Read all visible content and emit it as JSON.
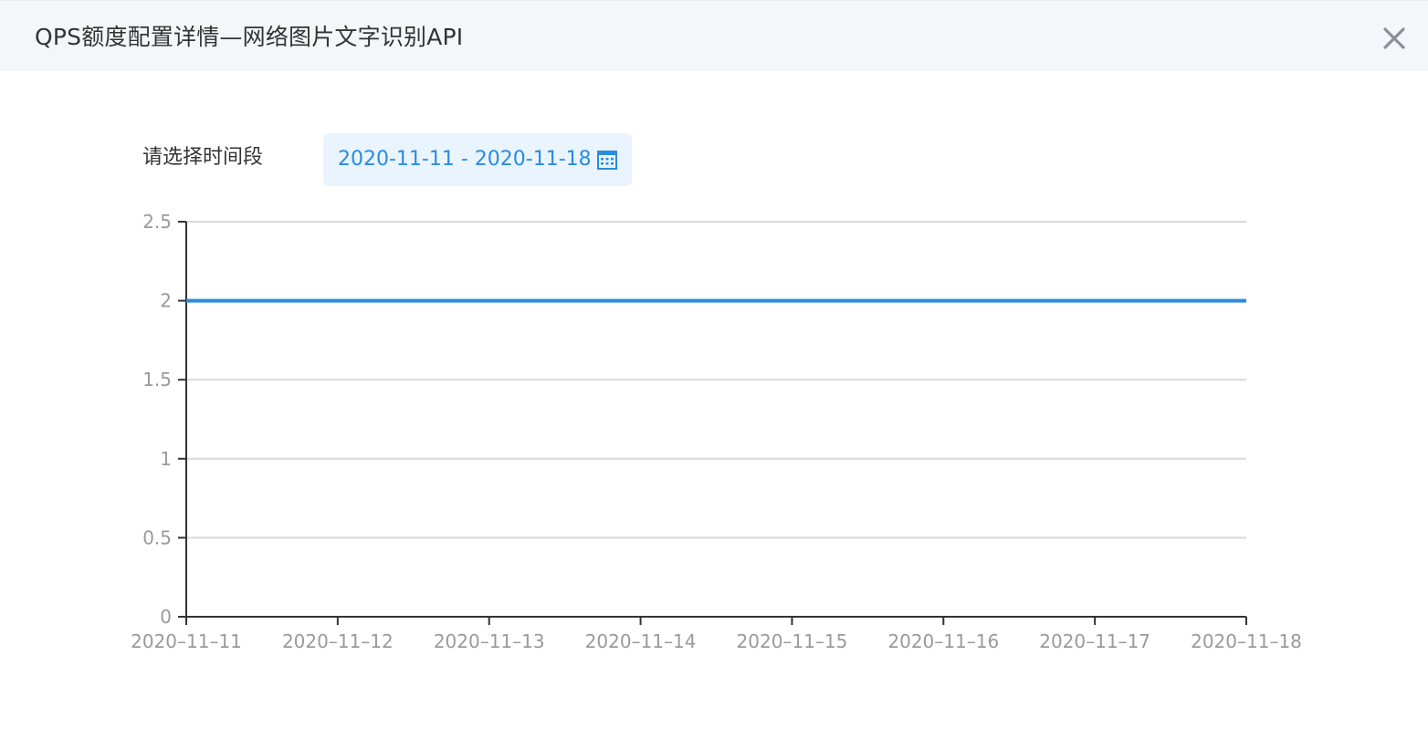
{
  "dialog": {
    "title": "QPS额度配置详情—网络图片文字识别API",
    "close_icon": "close-icon"
  },
  "filter": {
    "label": "请选择时间段",
    "date_range": "2020-11-11 - 2020-11-18",
    "calendar_icon": "calendar-icon"
  },
  "colors": {
    "accent": "#2b8bdf",
    "header_bg": "#f4f6fa",
    "date_bg": "#e9f4fe",
    "grid": "#d9d9d9",
    "axis": "#333333",
    "tick_text": "#9a9a9a"
  },
  "chart_data": {
    "type": "line",
    "x": [
      "2020-11-11",
      "2020-11-12",
      "2020-11-13",
      "2020-11-14",
      "2020-11-15",
      "2020-11-16",
      "2020-11-17",
      "2020-11-18"
    ],
    "x_tick_labels": [
      "2020–11–11",
      "2020–11–12",
      "2020–11–13",
      "2020–11–14",
      "2020–11–15",
      "2020–11–16",
      "2020–11–17",
      "2020–11–18"
    ],
    "series": [
      {
        "values": [
          2,
          2,
          2,
          2,
          2,
          2,
          2,
          2
        ],
        "color": "#2b8bdf"
      }
    ],
    "y_ticks": [
      0,
      0.5,
      1,
      1.5,
      2,
      2.5
    ],
    "y_tick_labels": [
      "0",
      "0.5",
      "1",
      "1.5",
      "2",
      "2.5"
    ],
    "ylim": [
      0,
      2.5
    ],
    "grid": true,
    "legend": "none"
  }
}
